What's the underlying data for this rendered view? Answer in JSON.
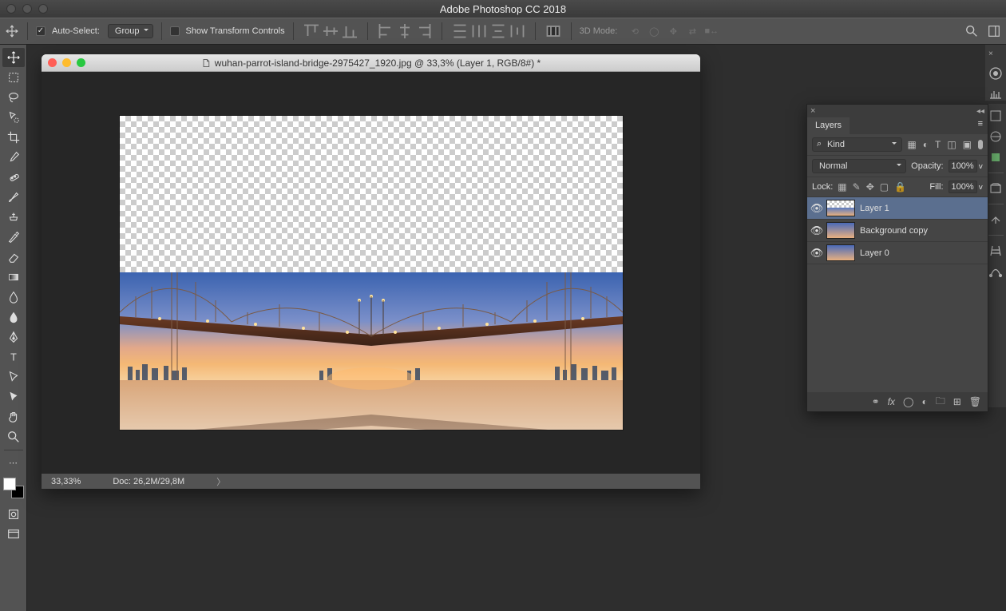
{
  "app": {
    "title": "Adobe Photoshop CC 2018"
  },
  "options": {
    "auto_select_label": "Auto-Select:",
    "auto_select_mode": "Group",
    "transform_label": "Show Transform Controls",
    "mode3d_label": "3D Mode:"
  },
  "document": {
    "filename": "wuhan-parrot-island-bridge-2975427_1920.jpg @ 33,3% (Layer 1, RGB/8#) *",
    "zoom": "33,33%",
    "doc_info": "Doc: 26,2M/29,8M"
  },
  "layers_panel": {
    "tab_label": "Layers",
    "kind_label": "Kind",
    "blend_mode": "Normal",
    "opacity_label": "Opacity:",
    "opacity_value": "100%",
    "lock_label": "Lock:",
    "fill_label": "Fill:",
    "fill_value": "100%",
    "layers": [
      {
        "name": "Layer 1",
        "selected": true
      },
      {
        "name": "Background copy",
        "selected": false
      },
      {
        "name": "Layer 0",
        "selected": false
      }
    ]
  }
}
